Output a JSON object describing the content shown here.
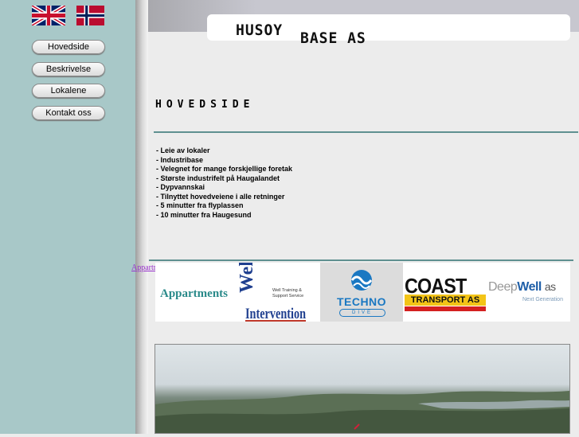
{
  "languages": [
    {
      "name": "English",
      "icon": "uk-flag-icon"
    },
    {
      "name": "Norsk",
      "icon": "norway-flag-icon"
    }
  ],
  "nav": {
    "home": "Hovedside",
    "description": "Beskrivelse",
    "premises": "Lokalene",
    "contact": "Kontakt oss"
  },
  "logo": {
    "part1": "HUSOY",
    "part2": "BASE AS"
  },
  "page_title": "HOVEDSIDE",
  "features": [
    "- Leie av lokaler",
    "- Industribase",
    "- Velegnet for mange forskjellige foretak",
    "- Største industrifelt på Haugalandet",
    "- Dypvannskai",
    "- Tilnyttet hovedveiene i alle retninger",
    "- 5 minutter fra flyplassen",
    "- 10 minutter fra Haugesund"
  ],
  "side_link": "Appartments",
  "partners": {
    "appartments": "Appartments",
    "well": {
      "line1": "Well",
      "line2": "Intervention",
      "tagline1": "Well Training &",
      "tagline2": "Support Service"
    },
    "techno": {
      "name": "TECHNO",
      "sub": "DIVE"
    },
    "coast": {
      "name": "COAST",
      "sub": "TRANSPORT AS"
    },
    "deepwell": {
      "deep": "Deep",
      "well": "Well",
      "as": "as",
      "tagline": "Next Generation"
    }
  },
  "colors": {
    "sidebar": "#a8c8c8",
    "rule": "#5f9090",
    "coast_yellow": "#f3c417",
    "techno_blue": "#1a78c2"
  }
}
